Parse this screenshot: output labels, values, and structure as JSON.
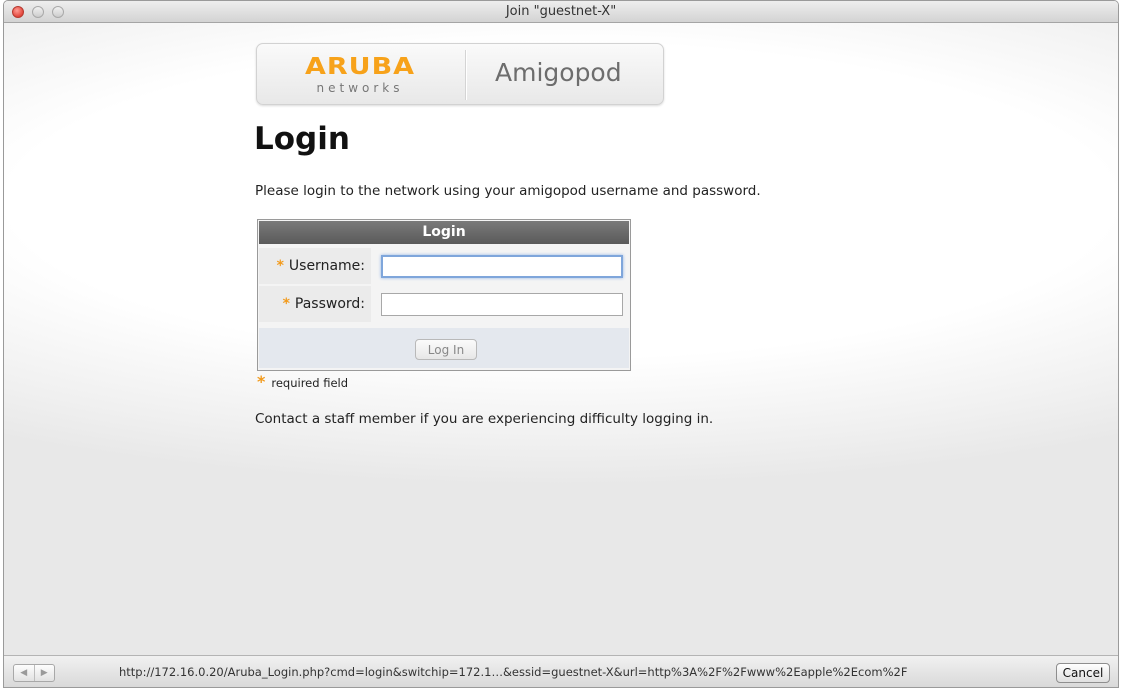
{
  "window": {
    "title": "Join \"guestnet-X\""
  },
  "banner": {
    "brand": "ARUBA",
    "brand_sub": "networks",
    "product": "Amigopod"
  },
  "page": {
    "title": "Login",
    "intro": "Please login to the network using your amigopod username and password.",
    "contact": "Contact a staff member if you are experiencing difficulty logging in."
  },
  "login_form": {
    "header": "Login",
    "username_label": "Username:",
    "username_value": "",
    "password_label": "Password:",
    "password_value": "",
    "required_marker": "*",
    "submit_label": "Log In",
    "required_note": "required field"
  },
  "statusbar": {
    "back_glyph": "◀",
    "forward_glyph": "▶",
    "url": "http://172.16.0.20/Aruba_Login.php?cmd=login&switchip=172.1…&essid=guestnet-X&url=http%3A%2F%2Fwww%2Eapple%2Ecom%2F",
    "cancel_label": "Cancel"
  },
  "colors": {
    "accent_orange": "#f7a21a",
    "form_header": "#6a6a6a",
    "focus_ring": "#7fa6db"
  }
}
